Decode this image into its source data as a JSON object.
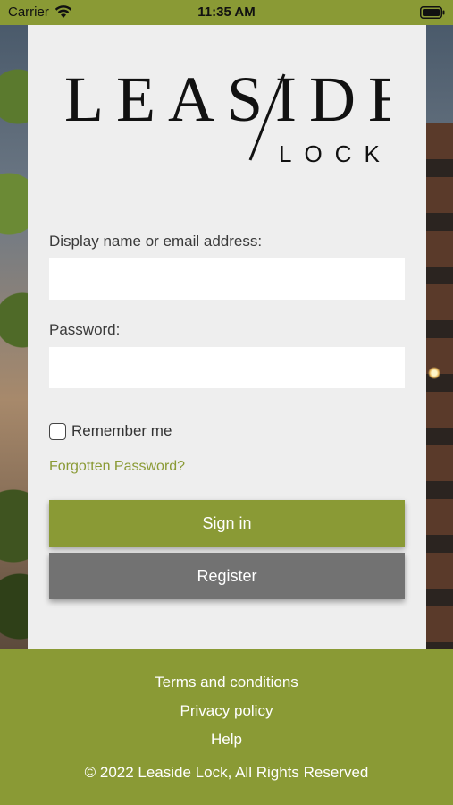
{
  "status_bar": {
    "carrier": "Carrier",
    "time": "11:35 AM"
  },
  "logo": {
    "word": "LEASIDE",
    "sub": "LOCK"
  },
  "form": {
    "username_label": "Display name or email address:",
    "username_value": "",
    "password_label": "Password:",
    "password_value": "",
    "remember_label": "Remember me",
    "remember_checked": false,
    "forgot_link": "Forgotten Password?",
    "signin_button": "Sign in",
    "register_button": "Register"
  },
  "footer": {
    "terms": "Terms and conditions",
    "privacy": "Privacy policy",
    "help": "Help",
    "copyright": "© 2022 Leaside Lock, All Rights Reserved"
  },
  "colors": {
    "accent": "#8a9a35",
    "panel": "#eeeeee",
    "register": "#727272"
  }
}
